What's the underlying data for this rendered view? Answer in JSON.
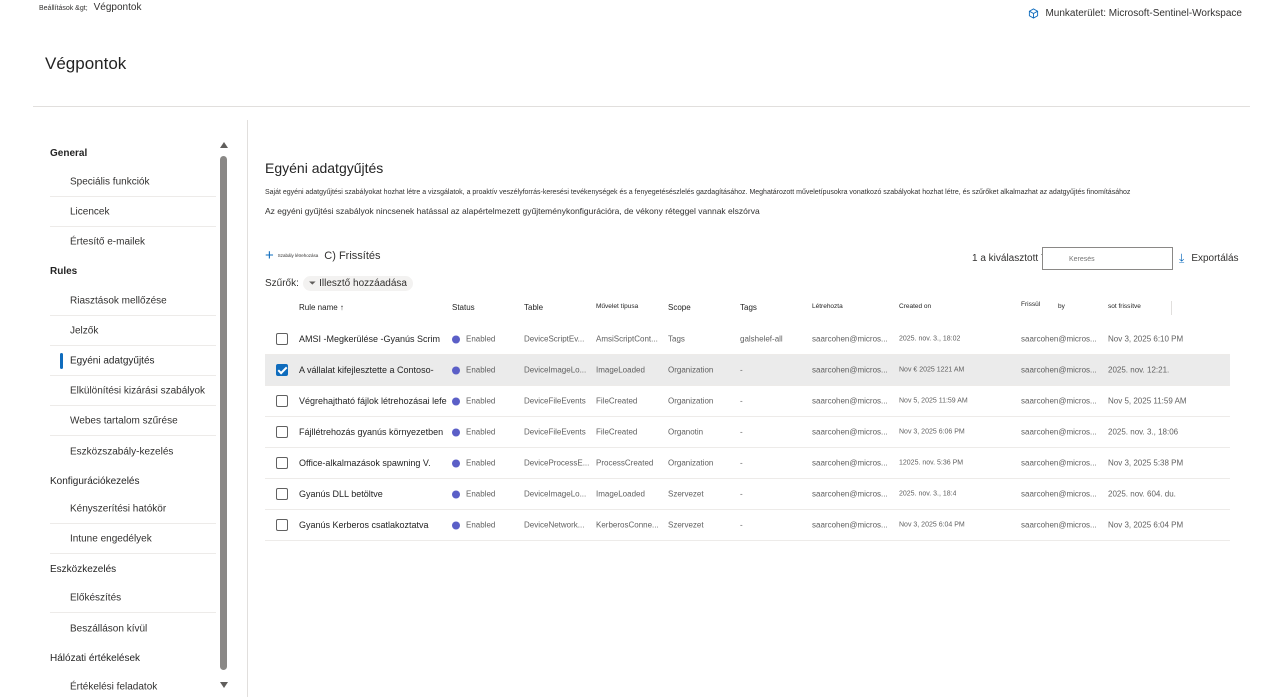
{
  "breadcrumb": {
    "parent": "Beállítások &gt;",
    "current": "Végpontok"
  },
  "workspace": {
    "label": "Munkaterület: Microsoft-Sentinel-Workspace",
    "icon": "cube-icon"
  },
  "page": {
    "title": "Végpontok"
  },
  "sidebar": {
    "groups": {
      "general": "General",
      "rules": "Rules",
      "config": "Konfigurációkezelés",
      "device": "Eszközkezelés",
      "network": "Hálózati értékelések"
    },
    "items": {
      "special": "Speciális funkciók",
      "licenses": "Licencek",
      "email": "Értesítő e-mailek",
      "suppression": "Riasztások mellőzése",
      "indicators": "Jelzők",
      "custom": "Egyéni adatgyűjtés",
      "exclusions": "Elkülönítési kizárási szabályok",
      "web": "Webes tartalom szűrése",
      "device_rules": "Eszközszabály-kezelés",
      "enforcement": "Kényszerítési hatókör",
      "intune": "Intune engedélyek",
      "onboarding": "Előkészítés",
      "offboarding": "Beszálláson kívül",
      "assessment": "Értékelési feladatok"
    }
  },
  "main": {
    "title": "Egyéni adatgyűjtés",
    "desc1": "Saját egyéni adatgyűjtési szabályokat hozhat létre a vizsgálatok, a proaktív veszélyforrás-keresési tevékenységek és a fenyegetésészlelés gazdagításához. Meghatározott műveletípusokra vonatkozó szabályokat hozhat létre, és szűrőket alkalmazhat az adatgyűjtés finomításához",
    "desc2": "Az egyéni gyűjtési szabályok nincsenek hatással az alapértelmezett gyűjteménykonfigurációra, de vékony réteggel vannak elszórva",
    "new_rule": "Szabály létrehozása",
    "refresh": "C) Frissítés",
    "selected_count": "1 a kiválasztott 7-ből",
    "search_placeholder": "Keresés",
    "export": "Exportálás",
    "filter_label": "Szűrők:",
    "add_filter": "Illesztő hozzáadása"
  },
  "table": {
    "headers": {
      "name": "Rule name ↑",
      "status": "Status",
      "table": "Table",
      "action": "Művelet típusa",
      "scope": "Scope",
      "tags": "Tags",
      "created_by": "Létrehozta",
      "created_on": "Created on",
      "updated_by": "Frissül",
      "by": "by",
      "updated": "sot frissítve"
    },
    "rows": [
      {
        "name": "AMSI -Megkerülése -Gyanús Scrim",
        "status": "Enabled",
        "table": "DeviceScriptEv...",
        "action": "AmsiScriptCont...",
        "scope": "Tags",
        "tags": "galshelef-all",
        "created_by": "saarcohen@micros...",
        "created_on": "2025. nov. 3., 18:02",
        "updated_by": "saarcohen@micros...",
        "updated": "Nov 3, 2025 6:10 PM"
      },
      {
        "name": "A vállalat kifejlesztette a Contoso-",
        "status": "Enabled",
        "table": "DeviceImageLo...",
        "action": "ImageLoaded",
        "scope": "Organization",
        "tags": "-",
        "created_by": "saarcohen@micros...",
        "created_on": "Nov € 2025 1221 AM",
        "updated_by": "saarcohen@micros...",
        "updated": "2025. nov. 12:21."
      },
      {
        "name": "Végrehajtható fájlok létrehozásai lefelé",
        "status": "Enabled",
        "table": "DeviceFileEvents",
        "action": "FileCreated",
        "scope": "Organization",
        "tags": "-",
        "created_by": "saarcohen@micros...",
        "created_on": "Nov 5, 2025 11:59 AM",
        "updated_by": "saarcohen@micros...",
        "updated": "Nov 5, 2025 11:59 AM"
      },
      {
        "name": "Fájllétrehozás gyanús környezetben",
        "status": "Enabled",
        "table": "DeviceFileEvents",
        "action": "FileCreated",
        "scope": "Organotin",
        "tags": "-",
        "created_by": "saarcohen@micros...",
        "created_on": "Nov 3, 2025 6:06 PM",
        "updated_by": "saarcohen@micros...",
        "updated": "2025. nov. 3., 18:06"
      },
      {
        "name": "Office-alkalmazások spawning V.",
        "status": "Enabled",
        "table": "DeviceProcessE...",
        "action": "ProcessCreated",
        "scope": "Organization",
        "tags": "-",
        "created_by": "saarcohen@micros...",
        "created_on": "12025. nov.      5:36 PM",
        "updated_by": "saarcohen@micros...",
        "updated": "Nov 3, 2025 5:38 PM"
      },
      {
        "name": "Gyanús DLL betöltve",
        "status": "Enabled",
        "table": "DeviceImageLo...",
        "action": "ImageLoaded",
        "scope": "Szervezet",
        "tags": "-",
        "created_by": "saarcohen@micros...",
        "created_on": "2025. nov. 3., 18:4",
        "updated_by": "saarcohen@micros...",
        "updated": "2025. nov. 604. du."
      },
      {
        "name": "Gyanús Kerberos csatlakoztatva",
        "status": "Enabled",
        "table": "DeviceNetwork...",
        "action": "KerberosConne...",
        "scope": "Szervezet",
        "tags": "-",
        "created_by": "saarcohen@micros...",
        "created_on": "Nov 3, 2025 6:04 PM",
        "updated_by": "saarcohen@micros...",
        "updated": "Nov 3, 2025 6:04 PM"
      }
    ]
  },
  "colors": {
    "accent": "#0f6cbd",
    "status_dot": "#5b5fc7",
    "selected_row": "#ebebeb"
  }
}
